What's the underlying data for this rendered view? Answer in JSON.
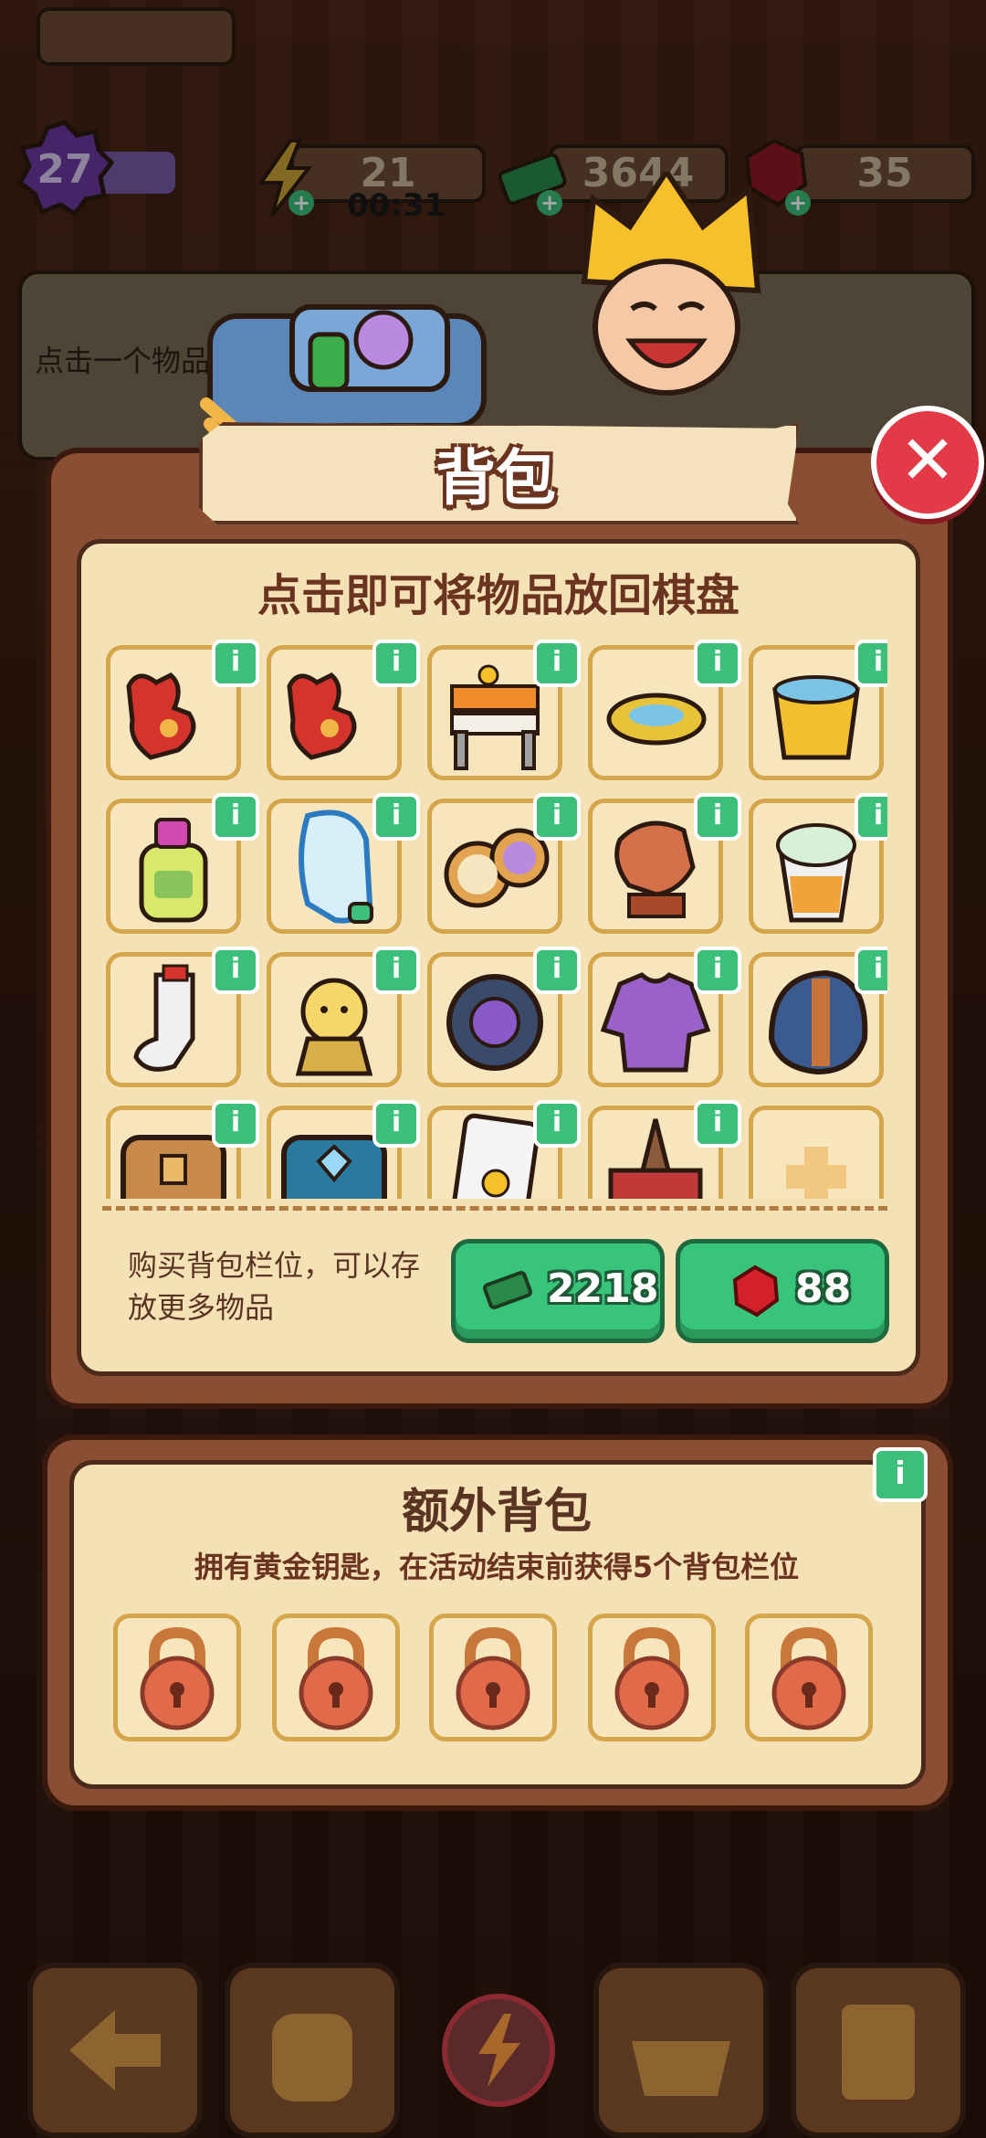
{
  "hud": {
    "level": "27",
    "energy": "21",
    "energy_timer": "00:31",
    "cash": "3644",
    "gems": "35"
  },
  "hint_text": "点击一个物品",
  "backpack": {
    "title": "背包",
    "subtitle": "点击即可将物品放回棋盘",
    "items": [
      {
        "name": "red-gloves"
      },
      {
        "name": "red-gloves"
      },
      {
        "name": "road-barrier"
      },
      {
        "name": "toilet-seat"
      },
      {
        "name": "water-bucket"
      },
      {
        "name": "detergent-bottle"
      },
      {
        "name": "water-jug"
      },
      {
        "name": "pocket-watches"
      },
      {
        "name": "dragon-statue"
      },
      {
        "name": "fruit-drink"
      },
      {
        "name": "dirty-sock"
      },
      {
        "name": "sprout-creature"
      },
      {
        "name": "car-tire"
      },
      {
        "name": "purple-sweater"
      },
      {
        "name": "helmet"
      },
      {
        "name": "wooden-chest"
      },
      {
        "name": "blue-chest"
      },
      {
        "name": "playing-card"
      },
      {
        "name": "traffic-cone-box"
      },
      {
        "name": "empty-add-slot"
      }
    ],
    "buy_text": "购买背包栏位，可以存放更多物品",
    "buy_cash_price": "2218",
    "buy_gem_price": "88"
  },
  "extra": {
    "title": "额外背包",
    "subtitle": "拥有黄金钥匙，在活动结束前获得5个背包栏位",
    "locked_slots": 5
  },
  "colors": {
    "panel": "#8a4e34",
    "inner": "#f4e1b6",
    "accent_green": "#38c47a",
    "close_red": "#e43a48"
  }
}
